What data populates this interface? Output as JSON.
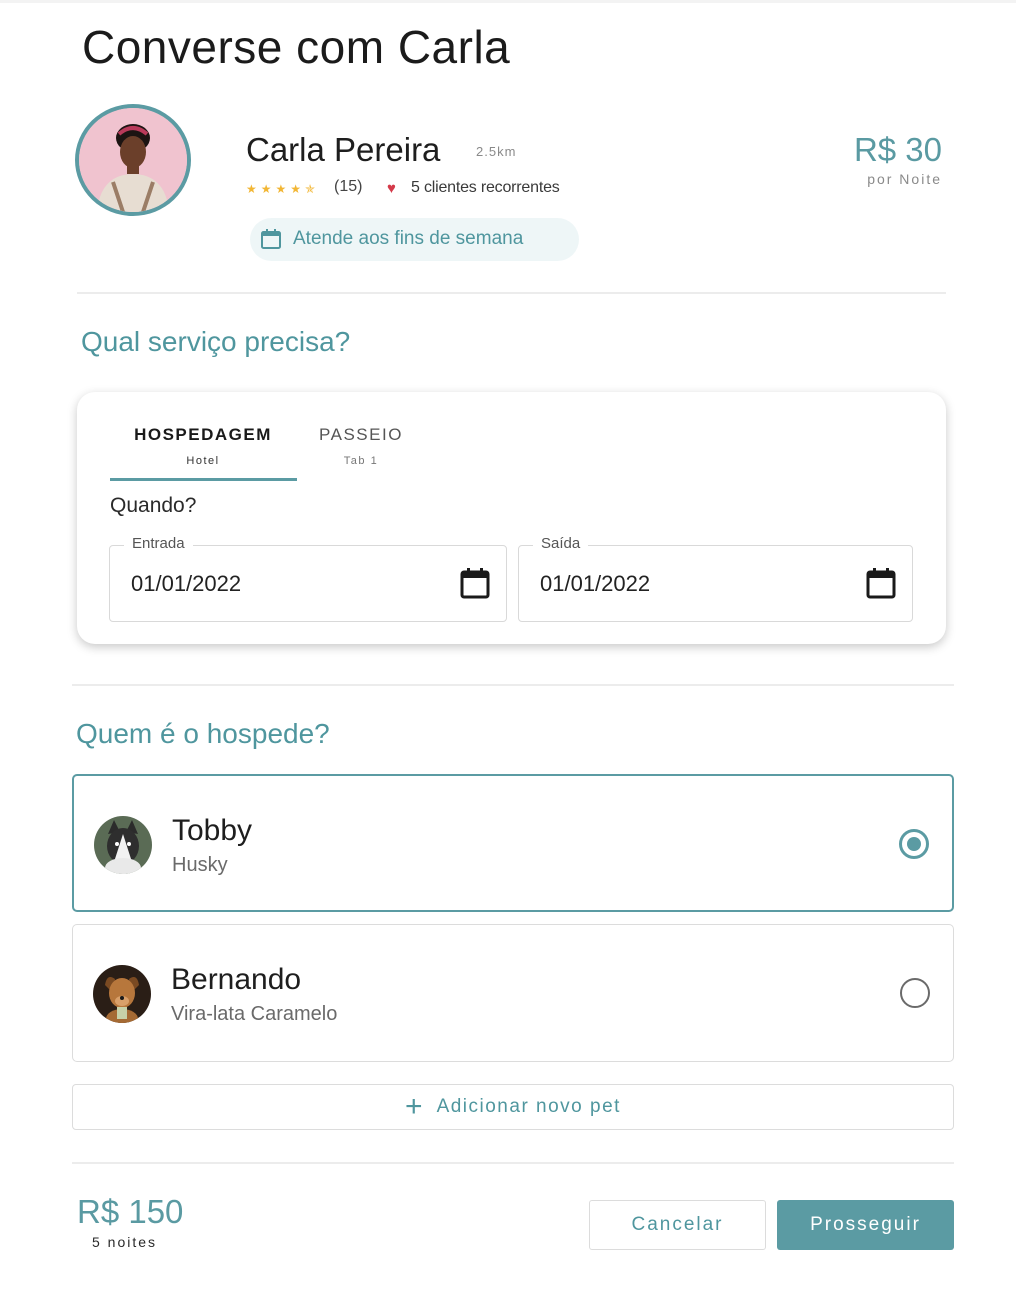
{
  "page": {
    "title": "Converse com Carla"
  },
  "sitter": {
    "name": "Carla Pereira",
    "distance": "2.5km",
    "stars": "★★★★✯",
    "reviews": "(15)",
    "recurring_clients": "5 clientes recorrentes",
    "availability": "Atende aos fins de semana",
    "price": "R$ 30",
    "price_unit": "por Noite"
  },
  "service": {
    "heading": "Qual serviço precisa?",
    "tabs": [
      {
        "label": "HOSPEDAGEM",
        "sub": "Hotel",
        "active": true
      },
      {
        "label": "PASSEIO",
        "sub": "Tab 1",
        "active": false
      }
    ],
    "when_label": "Quando?",
    "checkin": {
      "label": "Entrada",
      "value": "01/01/2022"
    },
    "checkout": {
      "label": "Saída",
      "value": "01/01/2022"
    }
  },
  "guests": {
    "heading": "Quem é o hospede?",
    "pets": [
      {
        "name": "Tobby",
        "breed": "Husky",
        "selected": true
      },
      {
        "name": "Bernando",
        "breed": "Vira-lata Caramelo",
        "selected": false
      }
    ],
    "add_label": "Adicionar novo pet"
  },
  "summary": {
    "total": "R$ 150",
    "nights": "5 noites"
  },
  "actions": {
    "cancel": "Cancelar",
    "continue": "Prosseguir"
  },
  "colors": {
    "accent": "#5b9ba3",
    "accent_text": "#4f969e",
    "star": "#f2b634",
    "heart": "#d43a4a"
  }
}
